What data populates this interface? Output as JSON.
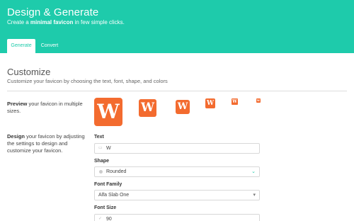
{
  "header": {
    "title": "Design & Generate",
    "subtitle_prefix": "Create a ",
    "subtitle_bold": "minimal favicon",
    "subtitle_suffix": " in few simple clicks.",
    "background": "#1ecbab"
  },
  "tabs": [
    {
      "label": "Generate",
      "active": true
    },
    {
      "label": "Convert",
      "active": false
    }
  ],
  "customize": {
    "title": "Customize",
    "description": "Customize your favicon by choosing the text, font, shape, and colors"
  },
  "preview": {
    "label_bold": "Preview",
    "label_rest": " your favicon in multiple sizes.",
    "letter": "W",
    "color": "#f36b2f",
    "sizes_count": 6
  },
  "design": {
    "label_bold": "Design",
    "label_rest": " your favicon by adjusting the settings to design and customize your favicon."
  },
  "fields": {
    "text": {
      "label": "Text",
      "value": "W"
    },
    "shape": {
      "label": "Shape",
      "value": "Rounded"
    },
    "font_family": {
      "label": "Font Family",
      "value": "Alfa Slab One"
    },
    "font_size": {
      "label": "Font Size",
      "value": "90"
    }
  },
  "icons": {
    "text_field": "text-icon",
    "shape_field": "circle-icon",
    "shape_dropdown": "chevron-down-icon",
    "font_dropdown": "chevron-down-icon",
    "font_size_field": "check-icon"
  }
}
